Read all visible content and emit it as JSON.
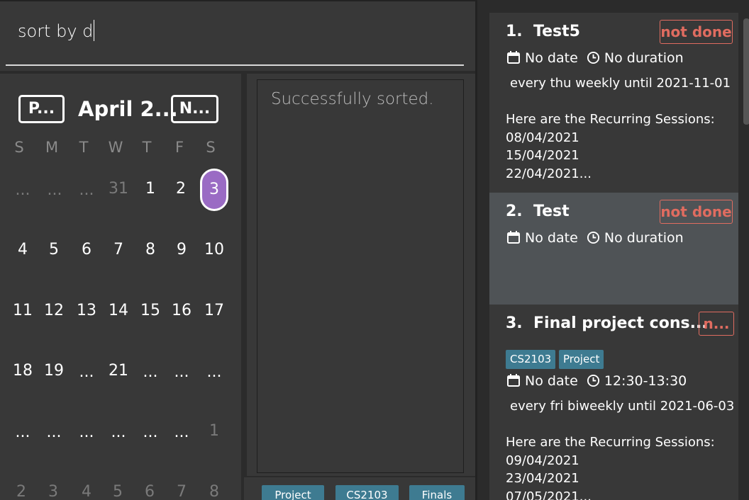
{
  "command": {
    "text": "sort by d"
  },
  "calendar": {
    "prev_label": "P...",
    "next_label": "N...",
    "month_label": "April 2...",
    "weekdays": [
      "S",
      "M",
      "T",
      "W",
      "T",
      "F",
      "S"
    ],
    "weeks": [
      [
        "...",
        "...",
        "...",
        "31",
        "1",
        "2",
        "3"
      ],
      [
        "4",
        "5",
        "6",
        "7",
        "8",
        "9",
        "10"
      ],
      [
        "11",
        "12",
        "13",
        "14",
        "15",
        "16",
        "17"
      ],
      [
        "18",
        "19",
        "...",
        "21",
        "...",
        "...",
        "..."
      ],
      [
        "...",
        "...",
        "...",
        "...",
        "...",
        "...",
        "1"
      ],
      [
        "2",
        "3",
        "4",
        "5",
        "6",
        "7",
        "8"
      ]
    ],
    "today": "3"
  },
  "result": {
    "message": "Successfully sorted."
  },
  "tag_filters": [
    "Project",
    "CS2103",
    "Finals"
  ],
  "tasks": [
    {
      "index": "1.",
      "title": "Test5",
      "status": "not done",
      "date": "No date",
      "duration": "No duration",
      "recurrence": "every thu weekly until 2021-11-01",
      "sessions_header": "Here are the Recurring Sessions:",
      "sessions": [
        "08/04/2021",
        "15/04/2021",
        "22/04/2021..."
      ]
    },
    {
      "index": "2.",
      "title": "Test",
      "status": "not done",
      "date": "No date",
      "duration": "No duration"
    },
    {
      "index": "3.",
      "title": "Final project cons...",
      "status": "n...",
      "tags": [
        "CS2103",
        "Project"
      ],
      "date": "No date",
      "duration": "12:30-13:30",
      "recurrence": "every fri biweekly until 2021-06-03",
      "sessions_header": "Here are the Recurring Sessions:",
      "sessions": [
        "09/04/2021",
        "23/04/2021",
        "07/05/2021..."
      ]
    }
  ],
  "colors": {
    "background": "#2b2b2b",
    "panel": "#383838",
    "selected_card": "#4f5356",
    "status_red": "#e06c60",
    "tag_teal": "#3e7b91",
    "today_purple": "#9a6bc4"
  },
  "icons": {
    "date": "calendar-icon",
    "duration": "clock-icon"
  }
}
